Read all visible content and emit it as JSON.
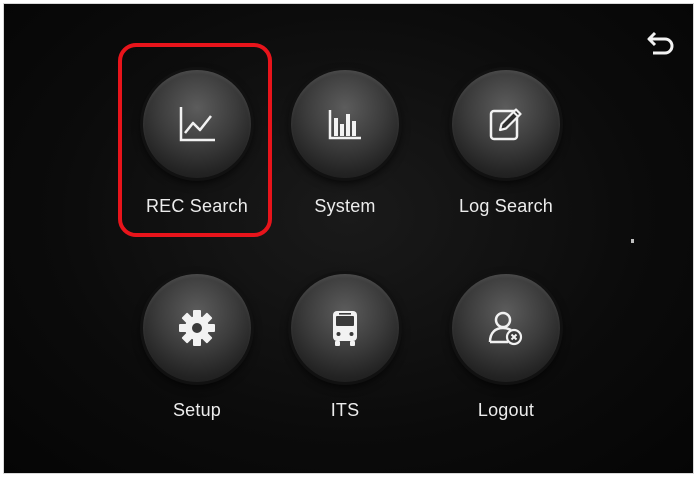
{
  "menu": {
    "items": [
      {
        "label": "REC Search",
        "icon": "line-chart-icon"
      },
      {
        "label": "System",
        "icon": "bar-chart-icon"
      },
      {
        "label": "Log Search",
        "icon": "edit-document-icon"
      },
      {
        "label": "Setup",
        "icon": "gear-icon"
      },
      {
        "label": "ITS",
        "icon": "bus-icon"
      },
      {
        "label": "Logout",
        "icon": "user-logout-icon"
      }
    ],
    "selected": "REC Search"
  },
  "toolbar": {
    "back_icon": "back-arrow-icon"
  },
  "colors": {
    "background": "#0b0b0b",
    "highlight": "#e8141b",
    "text": "#ececec",
    "icon": "#f2f2f2"
  }
}
